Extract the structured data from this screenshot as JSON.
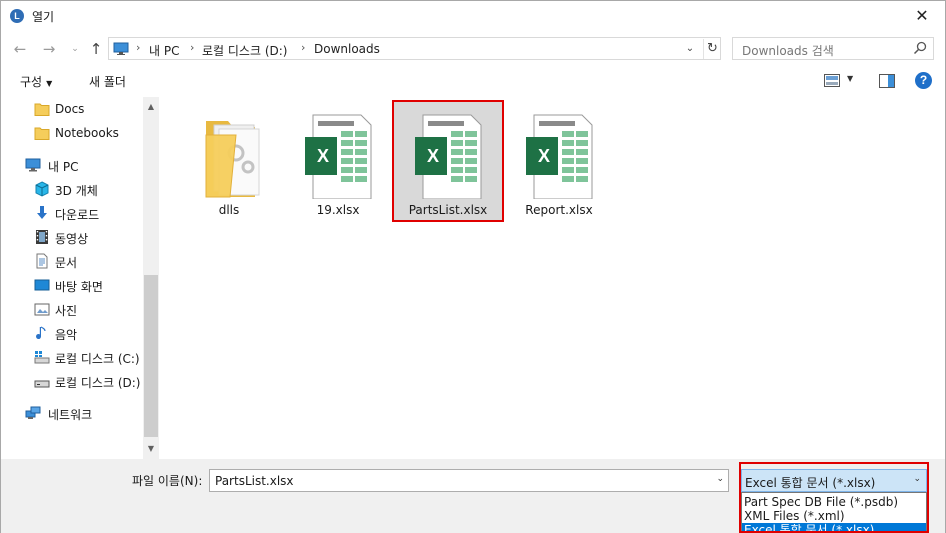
{
  "window": {
    "title": "열기",
    "app_icon_letter": "L",
    "close_glyph": "✕"
  },
  "nav": {
    "back_glyph": "←",
    "forward_glyph": "→",
    "recent_glyph": "⌄",
    "up_glyph": "↑",
    "breadcrumbs": [
      "내 PC",
      "로컬 디스크 (D:)",
      "Downloads"
    ],
    "crumb_separator": "›",
    "dropdown_glyph": "⌄",
    "refresh_glyph": "↻",
    "search_placeholder": "Downloads 검색"
  },
  "toolbar": {
    "organize_label": "구성",
    "organize_caret": "▼",
    "new_folder_label": "새 폴더",
    "view_caret": "▼",
    "help_glyph": "?"
  },
  "sidebar": {
    "items": [
      {
        "label": "Docs",
        "icon": "folder-icon"
      },
      {
        "label": "Notebooks",
        "icon": "folder-icon"
      },
      {
        "label": "내 PC",
        "icon": "pc-icon"
      },
      {
        "label": "3D 개체",
        "icon": "cube-3d-icon"
      },
      {
        "label": "다운로드",
        "icon": "download-arrow-icon"
      },
      {
        "label": "동영상",
        "icon": "film-icon"
      },
      {
        "label": "문서",
        "icon": "document-icon"
      },
      {
        "label": "바탕 화면",
        "icon": "desktop-icon"
      },
      {
        "label": "사진",
        "icon": "picture-icon"
      },
      {
        "label": "음악",
        "icon": "music-note-icon"
      },
      {
        "label": "로컬 디스크 (C:)",
        "icon": "drive-c-icon"
      },
      {
        "label": "로컬 디스크 (D:)",
        "icon": "drive-d-icon"
      },
      {
        "label": "네트워크",
        "icon": "network-icon"
      }
    ],
    "scroll_up_glyph": "▲",
    "scroll_down_glyph": "▼"
  },
  "files": [
    {
      "name": "dlls",
      "type": "folder",
      "selected": false
    },
    {
      "name": "19.xlsx",
      "type": "excel",
      "selected": false
    },
    {
      "name": "PartsList.xlsx",
      "type": "excel",
      "selected": true
    },
    {
      "name": "Report.xlsx",
      "type": "excel",
      "selected": false
    }
  ],
  "excel_letter": "X",
  "bottom": {
    "filename_label": "파일 이름(N):",
    "filename_value": "PartsList.xlsx",
    "filename_caret": "⌄",
    "filter_selected": "Excel 통합 문서 (*.xlsx)",
    "filter_caret": "⌄",
    "filter_options": [
      "Part Spec DB File (*.psdb)",
      "XML Files (*.xml)",
      "Excel 통합 문서 (*.xlsx)"
    ]
  },
  "colors": {
    "highlight_red": "#e00000",
    "excel_green": "#1e7145",
    "folder_yellow": "#f5cd5b",
    "selection_blue": "#0078d7"
  }
}
